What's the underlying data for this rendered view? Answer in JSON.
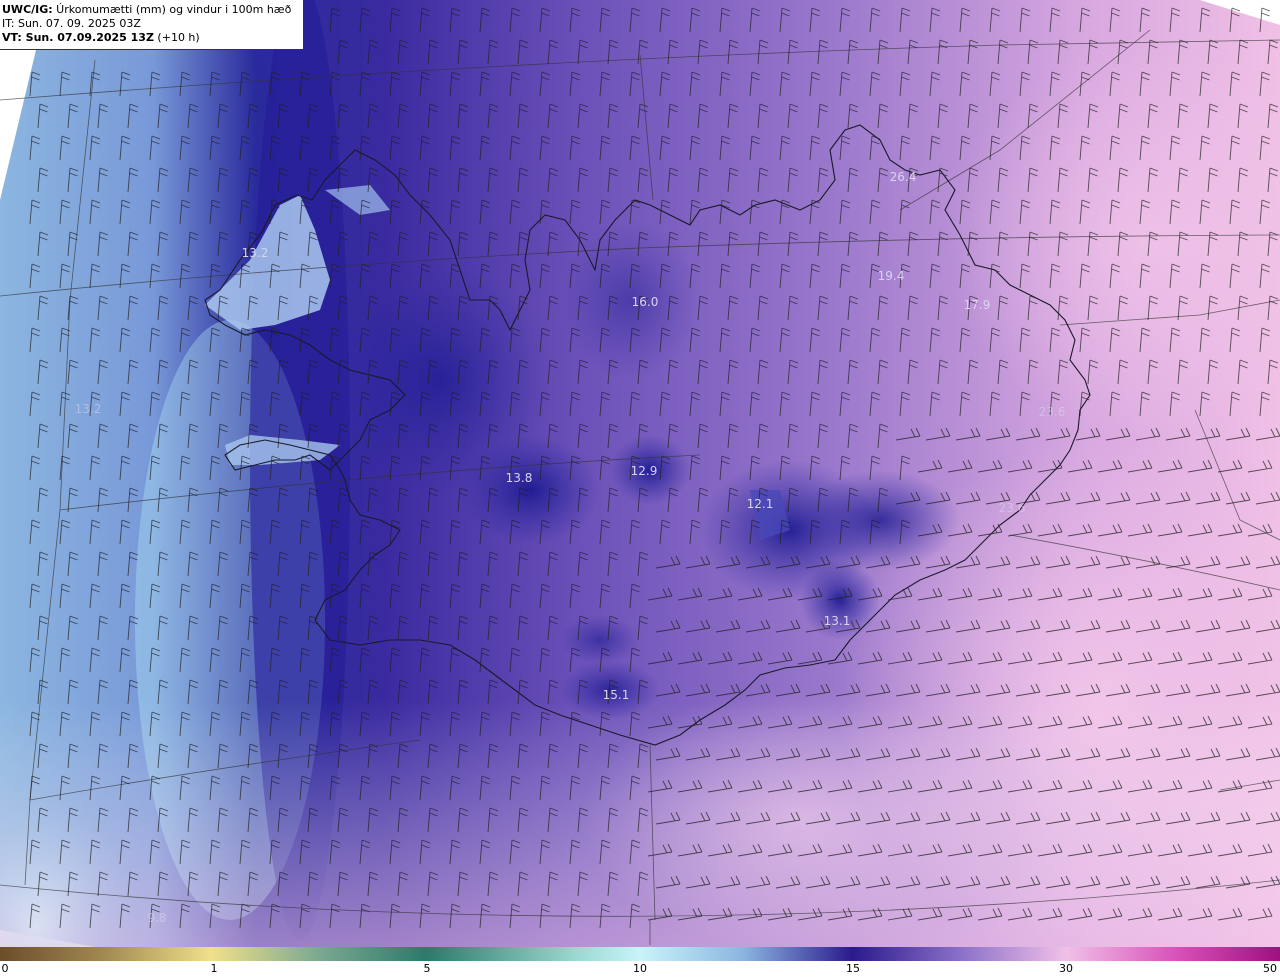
{
  "header": {
    "model_code": "UWC/IG:",
    "title": " Úrkomumætti (mm) og vindur i 100m hæð",
    "init_time": "IT: Sun. 07. 09. 2025 03Z",
    "valid_prefix": "VT: Sun. 07.09.2025 13Z",
    "valid_suffix": " (+10 h)"
  },
  "value_labels": [
    "13.2",
    "16.0",
    "26.4",
    "19.4",
    "17.9",
    "13.2",
    "23.6",
    "13.8",
    "12.9",
    "12.1",
    "23.6",
    "13.1",
    "15.1",
    "9.8"
  ],
  "colorbar": {
    "ticks": [
      "0",
      "1",
      "5",
      "10",
      "15",
      "30",
      "50"
    ],
    "colors": [
      "#6b4e2a",
      "#c8b070",
      "#f0e08a",
      "#2c7a6a",
      "#9ad8d0",
      "#b8f0f8",
      "#2a1a8c",
      "#b890d8",
      "#f0c0e8",
      "#c030a0",
      "#a01080"
    ]
  }
}
